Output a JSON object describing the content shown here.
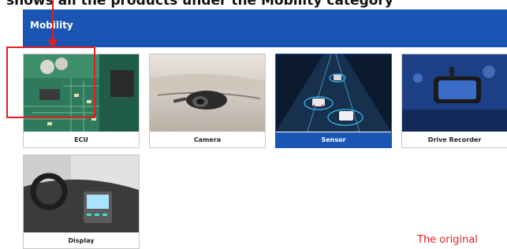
{
  "top_strip_text": "shows all the products under the Mobility category",
  "banner": {
    "title": "Mobility"
  },
  "tiles": [
    {
      "label": "ECU",
      "icon": "ecu-circuit-board-image"
    },
    {
      "label": "Camera",
      "icon": "car-camera-image"
    },
    {
      "label": "Sensor",
      "icon": "sensor-road-image",
      "selected": true
    },
    {
      "label": "Drive Recorder",
      "icon": "dashcam-image"
    },
    {
      "label": "Display",
      "icon": "car-dashboard-display-image"
    }
  ],
  "annotation": {
    "note": "The original ",
    "highlight_color": "#e02020"
  },
  "colors": {
    "brand": "#1a55b4",
    "annotation": "#e02020"
  }
}
